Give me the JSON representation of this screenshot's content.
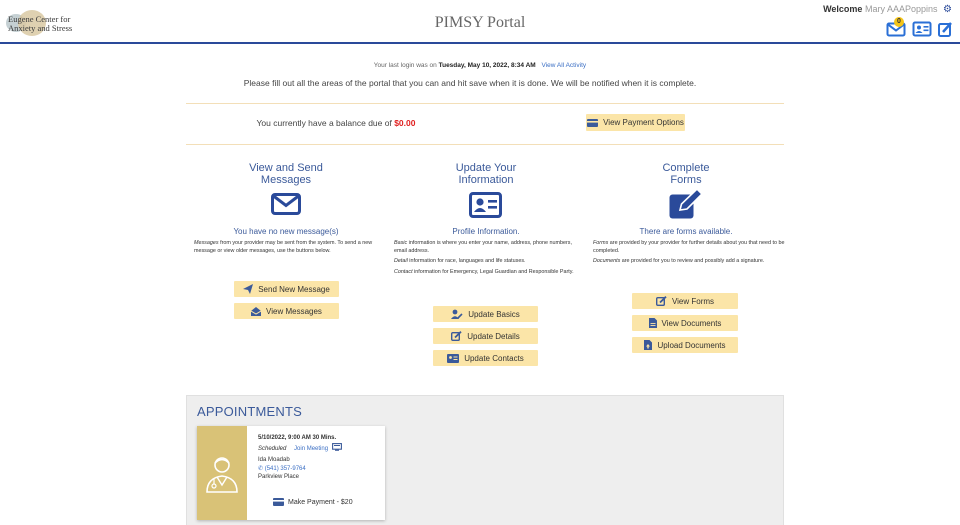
{
  "header": {
    "logo_line1": "Eugene Center for",
    "logo_line2": "Anxiety and Stress",
    "title": "PIMSY Portal",
    "welcome_label": "Welcome",
    "user_name": "Mary AAAPoppins",
    "message_badge": "0",
    "icons": [
      "gear-icon",
      "envelope-icon",
      "id-card-icon",
      "edit-icon"
    ]
  },
  "login": {
    "prefix": "Your last login was on",
    "datetime": "Tuesday, May 10, 2022, 8:34 AM",
    "view_activity": "View All Activity"
  },
  "instructions": "Please fill out all the areas of the portal that you can and hit save when it is done.  We will be notified when it is complete.",
  "balance": {
    "text": "You currently have a balance due of",
    "amount": "$0.00",
    "button": "View Payment Options"
  },
  "messages": {
    "title_line1": "View and Send",
    "title_line2": "Messages",
    "status": "You have no new message(s)",
    "desc_em": "Messages",
    "desc": " from your provider may be sent from the system. To send a new message or view older messages, use the buttons below.",
    "send_button": "Send New Message",
    "view_button": "View Messages"
  },
  "info": {
    "title_line1": "Update Your",
    "title_line2": "Information",
    "status": "Profile Information.",
    "basic_em": "Basic",
    "basic_desc": " information is where you enter your name, address, phone numbers, email address.",
    "detail_em": "Detail",
    "detail_desc": " information for race, languages and life statuses.",
    "contact_em": "Contact",
    "contact_desc": " information for Emergency, Legal Guardian and Responsible Party.",
    "basics_button": "Update Basics",
    "details_button": "Update Details",
    "contacts_button": "Update Contacts"
  },
  "forms": {
    "title_line1": "Complete",
    "title_line2": "Forms",
    "status": "There are forms available.",
    "forms_em": "Forms",
    "forms_desc": " are provided by your provider for further details about you that need to be completed.",
    "docs_em": "Documents",
    "docs_desc": " are provided for you to review and possibly add a signature.",
    "view_forms_button": "View Forms",
    "view_docs_button": "View Documents",
    "upload_docs_button": "Upload Documents"
  },
  "appointments": {
    "heading": "APPOINTMENTS",
    "items": [
      {
        "datetime": "5/10/2022, 9:00 AM  30 Mins.",
        "status": "Scheduled",
        "join": "Join Meeting",
        "provider": "Ida Moadab",
        "phone": "(541) 357-9764",
        "location": "Parkview Place",
        "payment": "Make Payment - $20"
      }
    ]
  },
  "colors": {
    "accent_blue": "#3b5a9a",
    "button_yellow": "#fbe5a8",
    "balance_red": "#e02020",
    "card_gold": "#d9c277"
  }
}
